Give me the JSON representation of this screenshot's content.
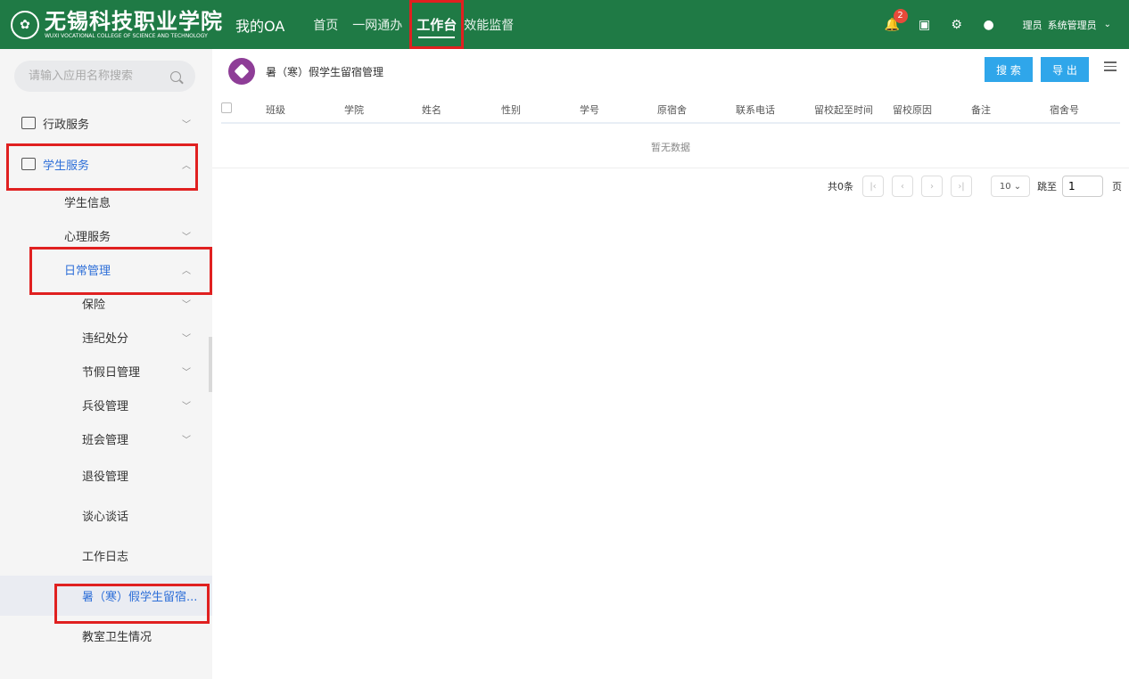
{
  "header": {
    "school_cn": "无锡科技职业学院",
    "school_en": "WUXI VOCATIONAL COLLEGE OF SCIENCE AND TECHNOLOGY",
    "my_oa": "我的OA",
    "nav": [
      "首页",
      "一网通办",
      "工作台",
      "效能监督"
    ],
    "active_nav": "工作台",
    "notification_count": "2",
    "user_role": "理员",
    "user_name": "系统管理员"
  },
  "sidebar": {
    "search_placeholder": "请输入应用名称搜索",
    "items": [
      {
        "label": "行政服务"
      },
      {
        "label": "学生服务"
      },
      {
        "label": "学生信息"
      },
      {
        "label": "心理服务"
      },
      {
        "label": "日常管理"
      },
      {
        "label": "保险"
      },
      {
        "label": "违纪处分"
      },
      {
        "label": "节假日管理"
      },
      {
        "label": "兵役管理"
      },
      {
        "label": "班会管理"
      },
      {
        "label": "退役管理"
      },
      {
        "label": "谈心谈话"
      },
      {
        "label": "工作日志"
      },
      {
        "label": "暑（寒）假学生留宿..."
      },
      {
        "label": "教室卫生情况"
      }
    ]
  },
  "content": {
    "page_title": "暑（寒）假学生留宿管理",
    "search_button": "搜 索",
    "export_button": "导 出",
    "columns": [
      "班级",
      "学院",
      "姓名",
      "性别",
      "学号",
      "原宿舍",
      "联系电话",
      "留校起至时间",
      "留校原因",
      "备注",
      "宿舍号"
    ],
    "empty_text": "暂无数据",
    "pager": {
      "total": "共0条",
      "page_size": "10",
      "jump_label": "跳至",
      "page_value": "1",
      "page_unit": "页"
    }
  },
  "colors": {
    "header_bg": "#1f7a45",
    "accent_blue": "#2e6fd8",
    "button_blue": "#2fa6ea",
    "highlight_red": "#e02020"
  }
}
